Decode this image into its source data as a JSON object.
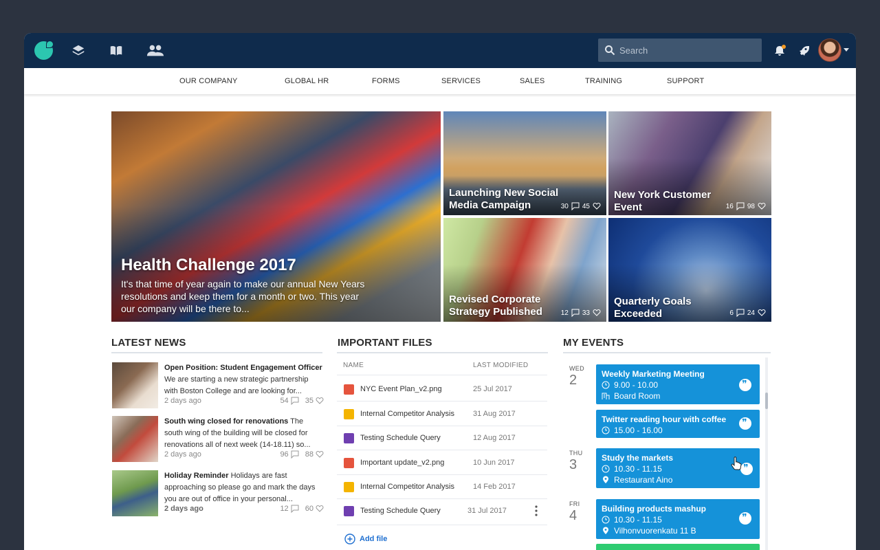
{
  "header": {
    "search_placeholder": "Search"
  },
  "menu": {
    "items": [
      "OUR COMPANY",
      "GLOBAL HR",
      "FORMS",
      "SERVICES",
      "SALES",
      "TRAINING",
      "SUPPORT"
    ]
  },
  "hero": {
    "title": "Health Challenge 2017",
    "excerpt": "It's that time of year again to make our annual New Years resolutions and  keep them for a month or two. This year our company will be there to..."
  },
  "tiles": [
    {
      "title_line1": "Launching New Social",
      "title_line2": "Media Campaign",
      "comments": "30",
      "likes": "45"
    },
    {
      "title_line1": "New York Customer",
      "title_line2": "Event",
      "comments": "16",
      "likes": "98"
    },
    {
      "title_line1": "Revised Corporate",
      "title_line2": "Strategy Published",
      "comments": "12",
      "likes": "33"
    },
    {
      "title_line1": "Quarterly Goals",
      "title_line2": "Exceeded",
      "comments": "6",
      "likes": "24"
    }
  ],
  "news": {
    "title": "LATEST NEWS",
    "items": [
      {
        "headline": "Open Position: Student Engagement Officer",
        "body": "We are starting a new strategic partnership with Boston College and are looking for...",
        "age": "2 days ago",
        "comments": "54",
        "likes": "35"
      },
      {
        "headline": "South wing closed for renovations",
        "body": "The south wing of the building will be closed for renovations all of next week (14-18.11) so...",
        "age": "2 days ago",
        "comments": "96",
        "likes": "88"
      },
      {
        "headline": "Holiday Reminder",
        "body": "Holidays are fast approaching so please go and mark the days you are out of office in your personal...",
        "age": "2 days ago",
        "comments": "12",
        "likes": "60"
      }
    ]
  },
  "files": {
    "title": "IMPORTANT FILES",
    "col_name": "NAME",
    "col_modified": "LAST MODIFIED",
    "rows": [
      {
        "name": "NYC Event Plan_v2.png",
        "date": "25 Jul 2017",
        "type": "image",
        "color": "#e5543d"
      },
      {
        "name": "Internal Competitor Analysis",
        "date": "31 Aug 2017",
        "type": "slides",
        "color": "#f4b400"
      },
      {
        "name": "Testing Schedule Query",
        "date": "12 Aug 2017",
        "type": "form",
        "color": "#6f3fb0"
      },
      {
        "name": "Important update_v2.png",
        "date": "10 Jun 2017",
        "type": "image",
        "color": "#e5543d"
      },
      {
        "name": "Internal Competitor Analysis",
        "date": "14 Feb 2017",
        "type": "slides",
        "color": "#f4b400"
      },
      {
        "name": "Testing Schedule Query",
        "date": "31 Jul 2017",
        "type": "form",
        "color": "#6f3fb0"
      }
    ],
    "add_label": "Add file"
  },
  "events": {
    "title": "MY EVENTS",
    "days": [
      {
        "dow": "WED",
        "num": "2"
      },
      {
        "dow": "THU",
        "num": "3"
      },
      {
        "dow": "FRI",
        "num": "4"
      }
    ],
    "items": [
      {
        "title": "Weekly Marketing Meeting",
        "time": "9.00 - 10.00",
        "place": "Board Room"
      },
      {
        "title": "Twitter reading hour with coffee",
        "time": "15.00 - 16.00"
      },
      {
        "title": "Study the markets",
        "time": "10.30 - 11.15",
        "place": "Restaurant Aino"
      },
      {
        "title": "Building products mashup",
        "time": "10.30 - 11.15",
        "place": "Vilhonvuorenkatu 11 B"
      }
    ]
  },
  "colors": {
    "topbar": "#0f2b4c",
    "accent": "#1592d9",
    "brand": "#2cc6b0"
  }
}
